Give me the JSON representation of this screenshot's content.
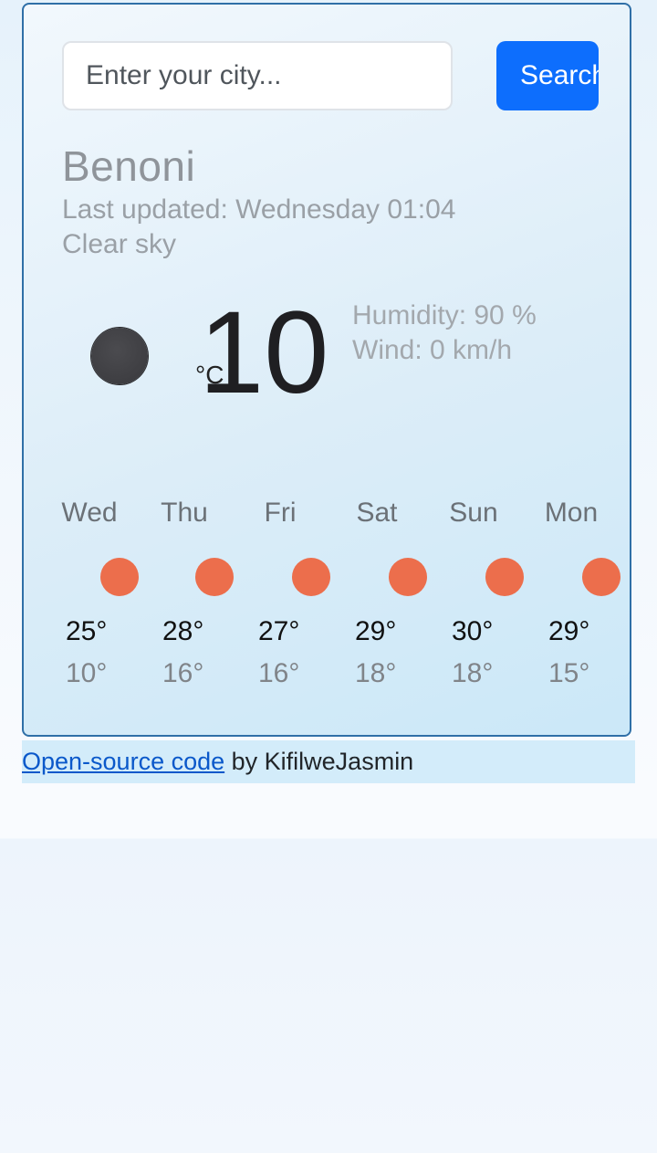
{
  "search": {
    "placeholder": "Enter your city...",
    "button_label": "Search"
  },
  "current": {
    "city": "Benoni",
    "last_updated": "Last updated: Wednesday 01:04",
    "description": "Clear sky",
    "icon": "moon-icon",
    "temperature": "10",
    "unit": "°C",
    "humidity": "Humidity: 90 %",
    "wind": "Wind: 0 km/h"
  },
  "forecast": [
    {
      "day": "Wed",
      "max": "25°",
      "min": "10°",
      "icon": "sun-icon"
    },
    {
      "day": "Thu",
      "max": "28°",
      "min": "16°",
      "icon": "sun-icon"
    },
    {
      "day": "Fri",
      "max": "27°",
      "min": "16°",
      "icon": "sun-icon"
    },
    {
      "day": "Sat",
      "max": "29°",
      "min": "18°",
      "icon": "sun-icon"
    },
    {
      "day": "Sun",
      "max": "30°",
      "min": "18°",
      "icon": "sun-icon"
    },
    {
      "day": "Mon",
      "max": "29°",
      "min": "15°",
      "icon": "sun-icon"
    }
  ],
  "footer": {
    "link_text": "Open-source code",
    "credit": " by KifilweJasmin"
  },
  "colors": {
    "accent": "#0d6efd",
    "sun": "#ec6e4c",
    "moon": "#444448",
    "card_border": "#2f6fa7"
  }
}
